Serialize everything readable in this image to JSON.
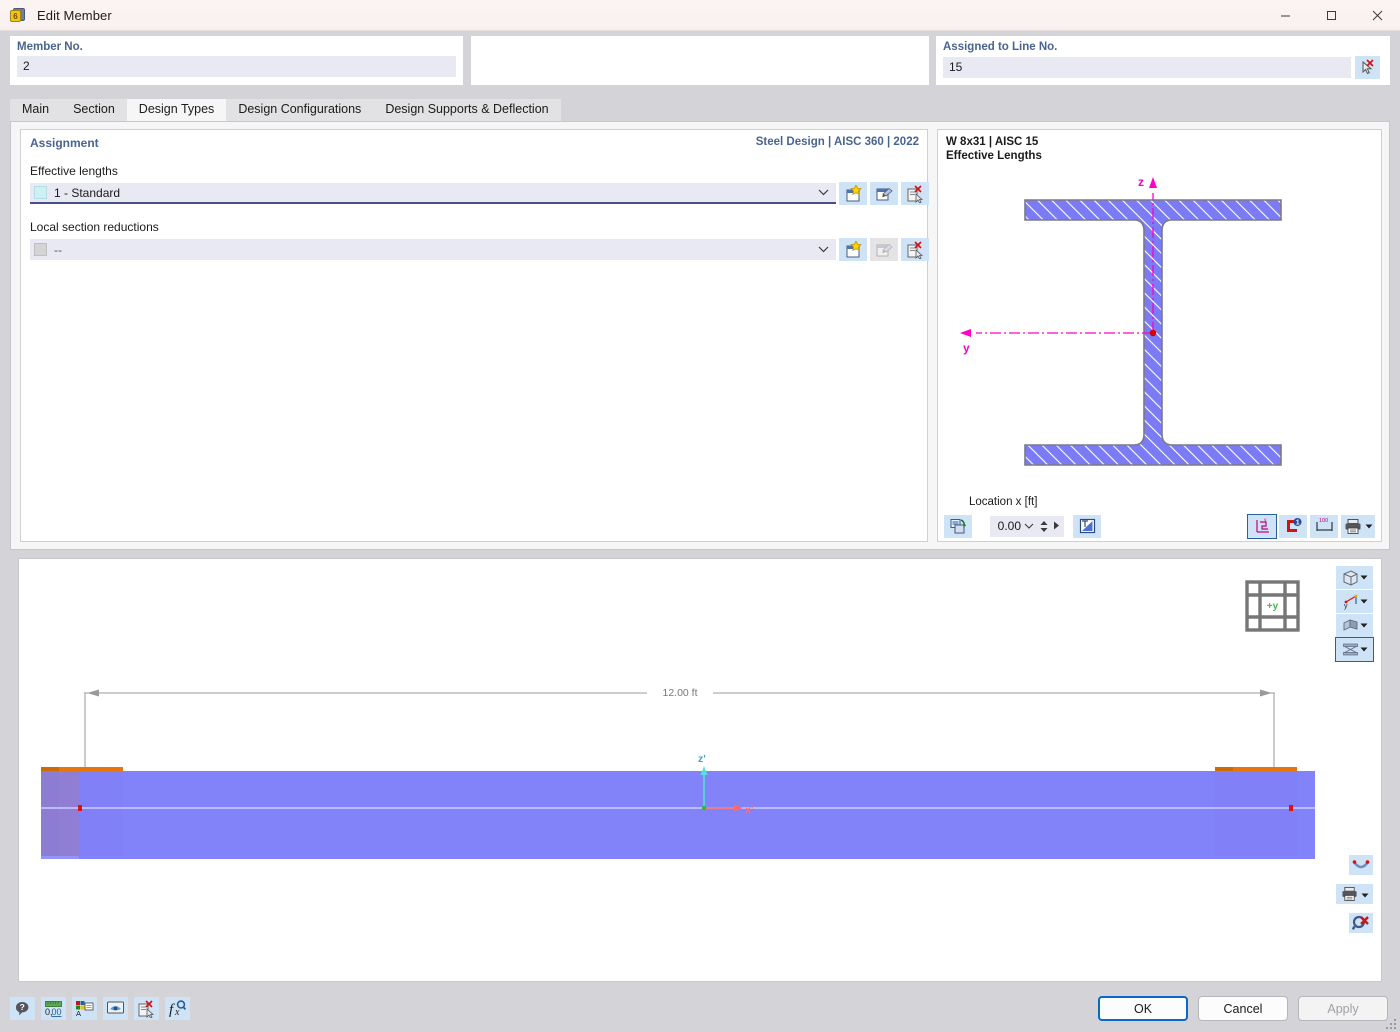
{
  "window": {
    "title": "Edit Member",
    "icon": "member-icon",
    "controls": {
      "minimize": "—",
      "maximize": "☐",
      "close": "✕"
    }
  },
  "header": {
    "member": {
      "label": "Member No.",
      "value": "2"
    },
    "empty": {
      "label": "",
      "value": ""
    },
    "line": {
      "label": "Assigned to Line No.",
      "value": "15",
      "pick_button": "select-line-icon"
    }
  },
  "tabs": [
    {
      "label": "Main",
      "active": false
    },
    {
      "label": "Section",
      "active": false
    },
    {
      "label": "Design Types",
      "active": true
    },
    {
      "label": "Design Configurations",
      "active": false
    },
    {
      "label": "Design Supports & Deflection",
      "active": false
    }
  ],
  "assignment": {
    "heading": "Assignment",
    "code": "Steel Design | AISC 360 | 2022",
    "groups": [
      {
        "label": "Effective lengths",
        "value": "1 - Standard",
        "swatch": "#cdf0f5",
        "caret": "⌄",
        "focused": true,
        "buttons": [
          {
            "name": "new-effective-length-button",
            "icon": "new-item-icon",
            "enabled": true
          },
          {
            "name": "edit-effective-length-button",
            "icon": "edit-item-icon",
            "enabled": true
          },
          {
            "name": "delete-effective-length-button",
            "icon": "delete-item-icon",
            "enabled": true
          }
        ]
      },
      {
        "label": "Local section reductions",
        "value": "--",
        "swatch": "#d4d4d4",
        "caret": "⌄",
        "focused": false,
        "buttons": [
          {
            "name": "new-section-reduction-button",
            "icon": "new-item-icon",
            "enabled": true
          },
          {
            "name": "edit-section-reduction-button",
            "icon": "edit-item-icon",
            "enabled": false
          },
          {
            "name": "delete-section-reduction-button",
            "icon": "delete-item-icon",
            "enabled": true
          }
        ]
      }
    ]
  },
  "section_view": {
    "title_line1": "W 8x31 | AISC 15",
    "title_line2": "Effective Lengths",
    "axis_z": "z",
    "axis_y": "y",
    "location_label": "Location x [ft]",
    "location_value": "0.00",
    "colors": {
      "section_fill": "#7b7bf5",
      "axis": "#ff00c8",
      "centroid": "#d00000"
    },
    "toolbar_left": [
      {
        "name": "rotate-section-button",
        "icon": "rotate-section-icon"
      }
    ],
    "toolbar_after_spin": [
      {
        "name": "section-properties-button",
        "icon": "blue-triangle-icon"
      }
    ],
    "toolbar_right": [
      {
        "name": "show-axes-button",
        "icon": "axes-icon",
        "selected": true
      },
      {
        "name": "show-support-button",
        "icon": "support-icon",
        "selected": false
      },
      {
        "name": "show-dimensions-button",
        "icon": "dimensions-icon",
        "selected": false
      },
      {
        "name": "print-section-button",
        "icon": "printer-icon",
        "selected": false
      }
    ]
  },
  "view3d": {
    "dimension_label": "12.00 ft",
    "axis_z": "z'",
    "axis_x": "x'",
    "nav_cube_label": "+y",
    "colors": {
      "member": "#8080f8",
      "support": "#e8750a",
      "dimension_line": "#9a9a9a"
    },
    "buttons_top": [
      {
        "name": "view-mode-button",
        "icon": "cube-icon"
      },
      {
        "name": "coordinate-system-button",
        "icon": "axes-xyz-icon"
      },
      {
        "name": "rendering-button",
        "icon": "render-icon"
      },
      {
        "name": "section-display-button",
        "icon": "section-display-icon",
        "selected": true
      }
    ],
    "buttons_bottom": [
      {
        "name": "deformation-button",
        "icon": "deformation-icon"
      },
      {
        "name": "print-view-button",
        "icon": "printer-icon"
      },
      {
        "name": "zoom-reset-button",
        "icon": "zoom-reset-icon"
      }
    ]
  },
  "bottom_bar": {
    "tools": [
      {
        "name": "help-button",
        "icon": "question-balloon-icon"
      },
      {
        "name": "units-button",
        "icon": "units-icon"
      },
      {
        "name": "display-properties-button",
        "icon": "display-properties-icon"
      },
      {
        "name": "view-settings-button",
        "icon": "view-settings-icon"
      },
      {
        "name": "delete-object-button",
        "icon": "delete-object-icon"
      },
      {
        "name": "formula-button",
        "icon": "formula-icon"
      }
    ],
    "ok": "OK",
    "cancel": "Cancel",
    "apply": "Apply"
  }
}
